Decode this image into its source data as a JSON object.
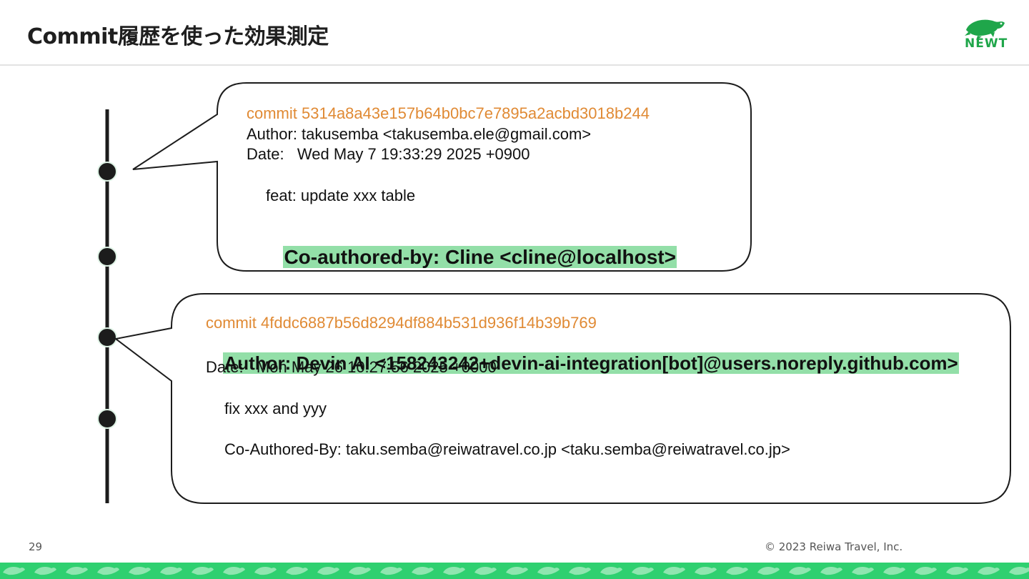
{
  "slide": {
    "title": "Commit履歴を使った効果測定",
    "page_number": "29",
    "copyright": "© 2023 Reiwa Travel, Inc.",
    "logo_text": "NEWT"
  },
  "commit1": {
    "hash_line": "commit 5314a8a43e157b64b0bc7e7895a2acbd3018b244",
    "author_line": "Author: takusemba <takusemba.ele@gmail.com>",
    "date_line": "Date:   Wed May 7 19:33:29 2025 +0900",
    "message": "feat: update xxx table",
    "coauthor": "Co-authored-by: Cline <cline@localhost>"
  },
  "commit2": {
    "hash_line": "commit 4fddc6887b56d8294df884b531d936f14b39b769",
    "author_line": "Author: Devin AI <158243242+devin-ai-integration[bot]@users.noreply.github.com>",
    "date_line": "Date:   Mon May 26 10:27:56 2025 +0000",
    "message": "fix xxx and yyy",
    "coauthor": "Co-Authored-By: taku.semba@reiwatravel.co.jp <taku.semba@reiwatravel.co.jp>"
  },
  "colors": {
    "hash": "#e08a34",
    "highlight": "#93dfa8",
    "brand_green": "#1fa64a",
    "footer_band": "#2fd070"
  },
  "icons": {
    "logo": "turtle-icon"
  }
}
